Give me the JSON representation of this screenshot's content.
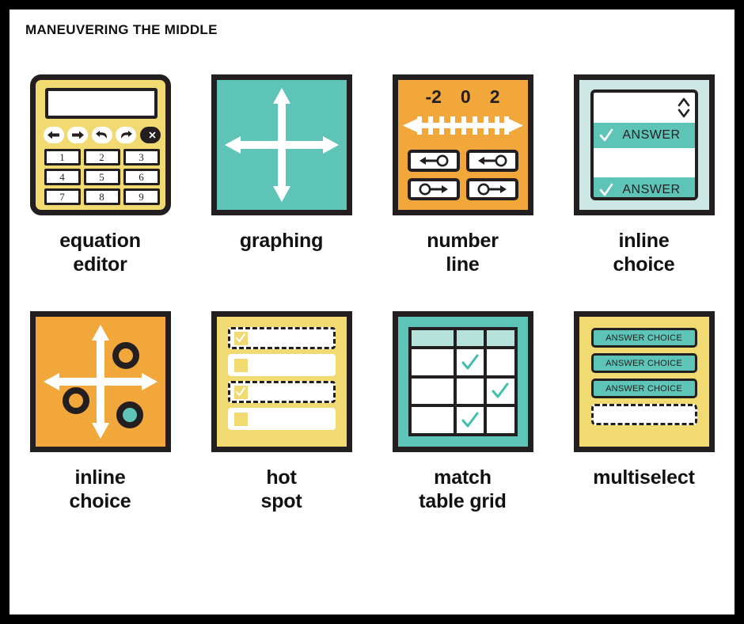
{
  "header": {
    "title": "MANEUVERING THE MIDDLE"
  },
  "colors": {
    "yellow": "#F2DA72",
    "teal": "#5FC4B8",
    "pale_teal": "#CDE8E4",
    "header_teal": "#B5E3DC",
    "orange": "#F2A73B",
    "outline": "#231f20",
    "white": "#FFFFFF",
    "page_border": "#000000"
  },
  "items": [
    {
      "id": "equation-editor",
      "caption_lines": [
        "equation",
        "editor"
      ],
      "background": "#F2DA72",
      "display_value": "",
      "op_buttons": [
        {
          "icon": "arrow-left-icon",
          "style": "light"
        },
        {
          "icon": "arrow-right-icon",
          "style": "light"
        },
        {
          "icon": "undo-icon",
          "style": "light"
        },
        {
          "icon": "redo-icon",
          "style": "light"
        },
        {
          "icon": "backspace-icon",
          "style": "dark"
        }
      ],
      "keys": [
        "1",
        "2",
        "3",
        "4",
        "5",
        "6",
        "7",
        "8",
        "9"
      ]
    },
    {
      "id": "graphing",
      "caption_lines": [
        "graphing"
      ],
      "background": "#5FC4B8",
      "axes_icon": "coordinate-axes-icon",
      "axes_color": "#FFFFFF"
    },
    {
      "id": "number-line",
      "caption_lines": [
        "number",
        "line"
      ],
      "background": "#F2A73B",
      "tick_labels": [
        "-2",
        "0",
        "2"
      ],
      "tick_count": 9,
      "line_color": "#FFFFFF",
      "buttons": [
        {
          "icon": "ray-left-open-icon",
          "label": "←O"
        },
        {
          "icon": "ray-left-open-icon",
          "label": "←O"
        },
        {
          "icon": "ray-right-open-icon",
          "label": "O→"
        },
        {
          "icon": "ray-right-open-icon",
          "label": "O→"
        }
      ]
    },
    {
      "id": "inline-choice-dropdown",
      "caption_lines": [
        "inline",
        "choice"
      ],
      "background": "#CDE8E4",
      "rows": [
        {
          "type": "field",
          "label": "",
          "selected": false,
          "stepper": true
        },
        {
          "type": "option",
          "label": "ANSWER",
          "selected": true
        },
        {
          "type": "field",
          "label": "",
          "selected": false
        },
        {
          "type": "option",
          "label": "ANSWER",
          "selected": true
        }
      ]
    },
    {
      "id": "inline-choice-plot",
      "caption_lines": [
        "inline",
        "choice"
      ],
      "background": "#F2A73B",
      "axes_icon": "coordinate-axes-icon",
      "points": [
        {
          "quadrant": 1,
          "filled": false,
          "fill": "#F2A73B"
        },
        {
          "quadrant": 3,
          "filled": false,
          "fill": "#F2A73B"
        },
        {
          "quadrant": 4,
          "filled": true,
          "fill": "#5FC4B8"
        }
      ]
    },
    {
      "id": "hot-spot",
      "caption_lines": [
        "hot",
        "spot"
      ],
      "background": "#F2DA72",
      "rows": [
        {
          "checked": true,
          "border": "dark"
        },
        {
          "checked": false,
          "border": "light"
        },
        {
          "checked": true,
          "border": "dark"
        },
        {
          "checked": false,
          "border": "light"
        }
      ]
    },
    {
      "id": "match-table-grid",
      "caption_lines": [
        "match",
        "table grid"
      ],
      "background": "#5FC4B8",
      "columns": 3,
      "header_row": [
        "",
        "",
        ""
      ],
      "body_rows": [
        [
          "",
          "✓",
          ""
        ],
        [
          "",
          "",
          "✓"
        ],
        [
          "",
          "✓",
          ""
        ]
      ],
      "check_color": "#3FBFAE"
    },
    {
      "id": "multiselect",
      "caption_lines": [
        "multiselect"
      ],
      "background": "#F2DA72",
      "choices": [
        "ANSWER CHOICE",
        "ANSWER CHOICE",
        "ANSWER CHOICE"
      ],
      "drop_zone": {
        "label": "",
        "style": "dashed"
      }
    }
  ]
}
